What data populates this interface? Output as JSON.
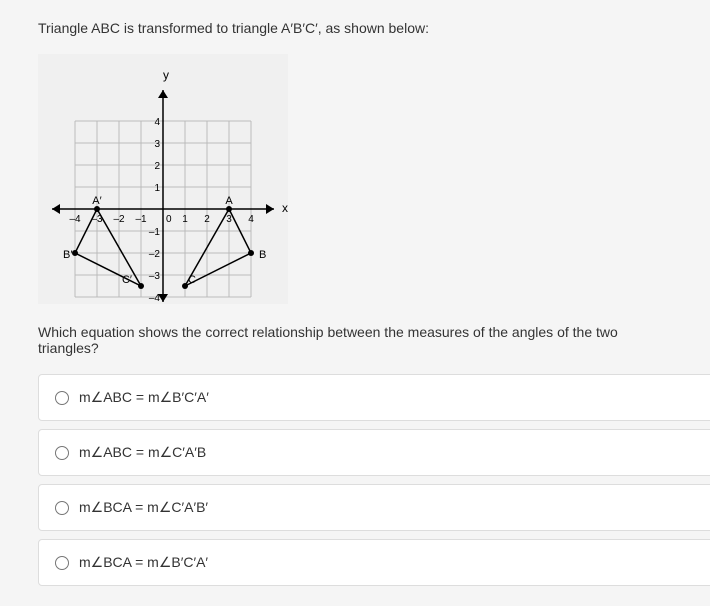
{
  "question_intro": "Triangle ABC is transformed to triangle A′B′C′, as shown below:",
  "question_prompt": "Which equation shows the correct relationship between the measures of the angles of the two triangles?",
  "options": [
    "m∠ABC = m∠B′C′A′",
    "m∠ABC = m∠C′A′B",
    "m∠BCA = m∠C′A′B′",
    "m∠BCA = m∠B′C′A′"
  ],
  "chart_data": {
    "type": "diagram",
    "axis_labels": {
      "x": "x",
      "y": "y"
    },
    "x_ticks": [
      -4,
      -3,
      -2,
      -1,
      0,
      1,
      2,
      3,
      4
    ],
    "y_ticks": [
      -4,
      -3,
      -2,
      -1,
      1,
      2,
      3,
      4
    ],
    "xlim": [
      -5,
      5
    ],
    "ylim": [
      -5,
      5
    ],
    "triangles": [
      {
        "name": "ABC",
        "vertices": {
          "A": [
            3,
            0
          ],
          "B": [
            4,
            -2
          ],
          "C": [
            1,
            -3.5
          ]
        }
      },
      {
        "name": "A'B'C'",
        "vertices": {
          "A'": [
            -3,
            0
          ],
          "B'": [
            -4,
            -2
          ],
          "C'": [
            -1,
            -3.5
          ]
        }
      }
    ]
  }
}
